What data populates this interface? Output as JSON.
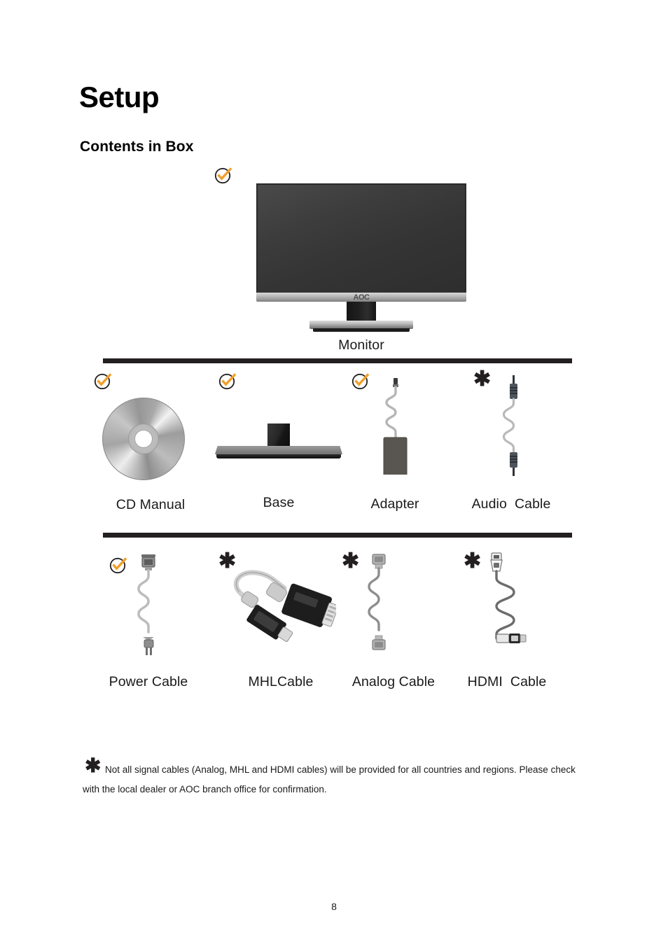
{
  "document": {
    "page_title": "Setup",
    "section_title": "Contents in Box",
    "page_number": "8"
  },
  "featured_item": {
    "label": "Monitor",
    "status_icon": "check-circle-icon",
    "brand_logo": "AOC"
  },
  "rows": [
    {
      "row_name": "row-1",
      "items": [
        {
          "label": "CD Manual",
          "status": "check",
          "icon": "cd-disc-icon"
        },
        {
          "label": "Base",
          "status": "check",
          "icon": "monitor-base-icon"
        },
        {
          "label": "Adapter",
          "status": "check",
          "icon": "power-adapter-icon"
        },
        {
          "label": "Audio  Cable",
          "status": "asterisk",
          "icon": "audio-cable-icon"
        }
      ]
    },
    {
      "row_name": "row-2",
      "items": [
        {
          "label": "Power Cable",
          "status": "check",
          "icon": "power-cable-icon"
        },
        {
          "label": "MHLCable",
          "status": "asterisk",
          "icon": "mhl-cable-icon"
        },
        {
          "label": "Analog Cable",
          "status": "asterisk",
          "icon": "analog-cable-icon"
        },
        {
          "label": "HDMI  Cable",
          "status": "asterisk",
          "icon": "hdmi-cable-icon"
        }
      ]
    }
  ],
  "status_marks": {
    "check_label": "included",
    "asterisk_label": "*",
    "asterisk_glyph": "✱"
  },
  "footnote": {
    "marker": "✱",
    "text": "Not all signal cables (Analog, MHL and HDMI cables) will be provided for all countries and regions. Please check with the local dealer or AOC branch office for confirmation."
  },
  "colors": {
    "accent_check": "#F0A02A",
    "rule": "#231F20",
    "text": "#1A1A1A"
  }
}
